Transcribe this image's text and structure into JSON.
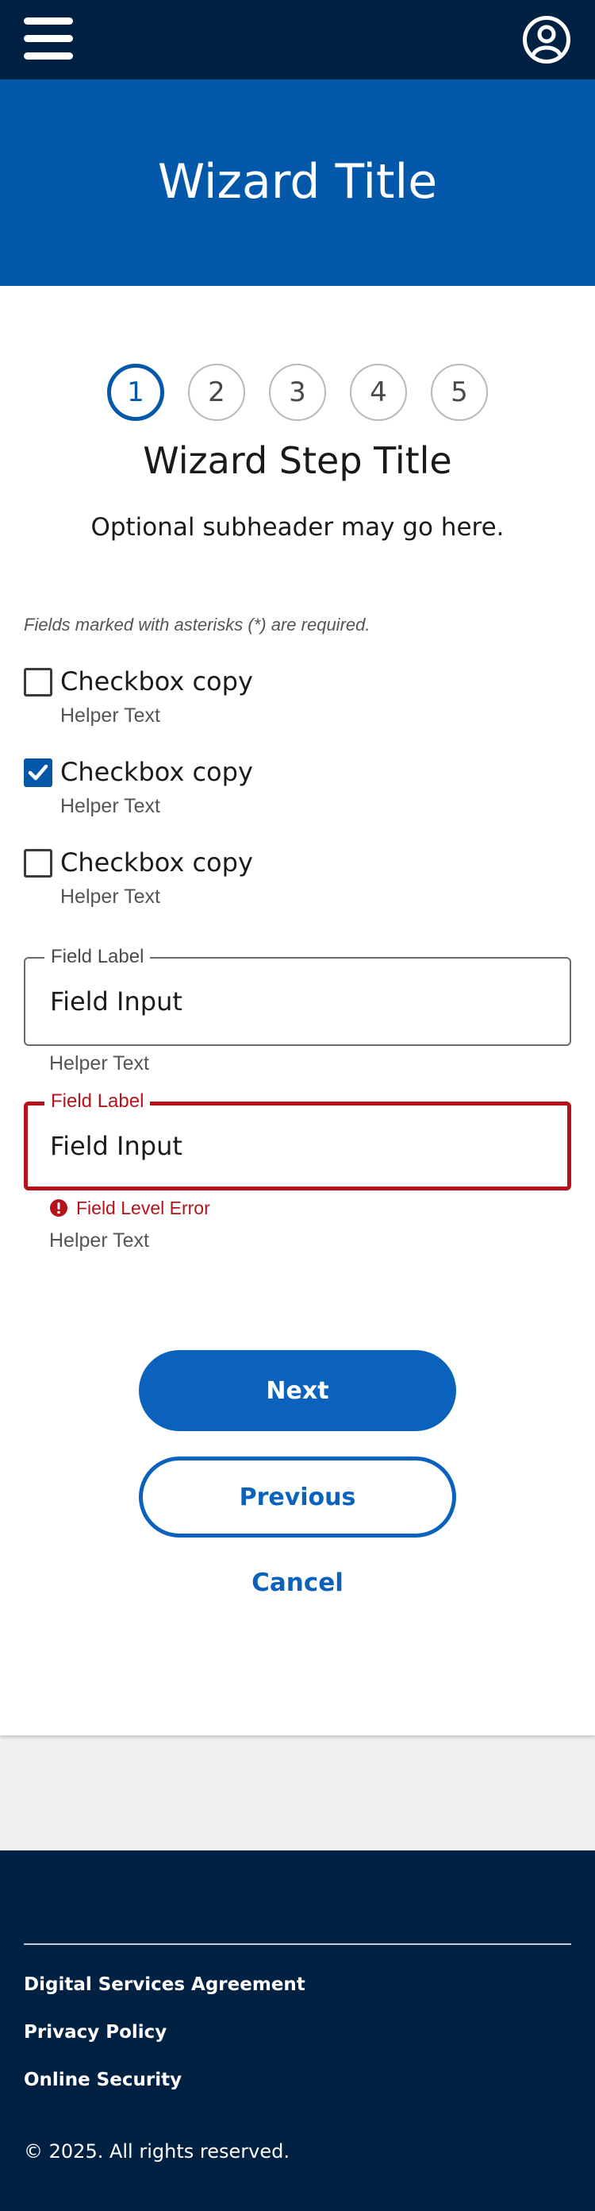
{
  "header": {
    "menu_icon": "hamburger-menu-icon",
    "profile_icon": "user-circle-icon",
    "colors": {
      "topbar": "#002142",
      "hero": "#0458a9"
    }
  },
  "hero": {
    "title": "Wizard Title"
  },
  "wizard": {
    "steps": [
      "1",
      "2",
      "3",
      "4",
      "5"
    ],
    "current_step": 1,
    "step_title": "Wizard Step Title",
    "subheader": "Optional subheader may go here.",
    "required_note": "Fields marked with asterisks (*) are required."
  },
  "checkboxes": [
    {
      "label": "Checkbox copy",
      "helper": "Helper Text",
      "checked": false
    },
    {
      "label": "Checkbox copy",
      "helper": "Helper Text",
      "checked": true
    },
    {
      "label": "Checkbox copy",
      "helper": "Helper Text",
      "checked": false
    }
  ],
  "fields": [
    {
      "label": "Field Label",
      "value": "Field Input",
      "helper": "Helper Text",
      "error": ""
    },
    {
      "label": "Field Label",
      "value": "Field Input",
      "helper": "Helper Text",
      "error": "Field Level Error"
    }
  ],
  "buttons": {
    "next": "Next",
    "previous": "Previous",
    "cancel": "Cancel"
  },
  "footer": {
    "links": [
      "Digital Services Agreement",
      "Privacy Policy",
      "Online Security"
    ],
    "copyright": "© 2025. All rights reserved."
  },
  "colors": {
    "primary": "#0a62bd",
    "error": "#b5121b",
    "footer": "#002142"
  }
}
